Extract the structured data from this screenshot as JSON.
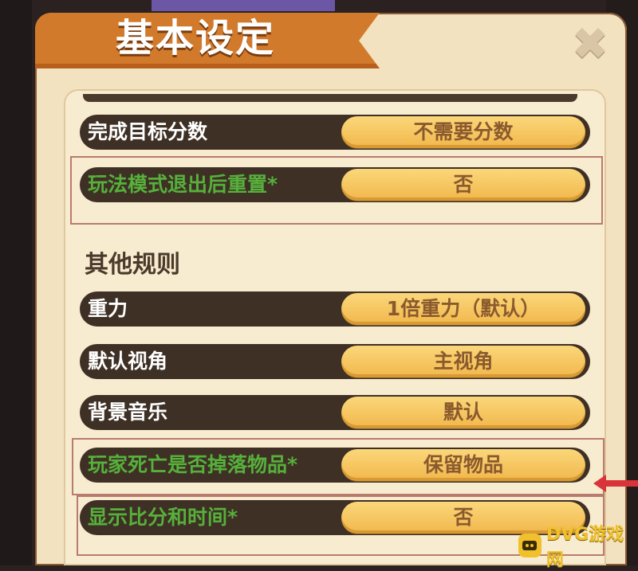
{
  "header": {
    "title": "基本设定"
  },
  "close": {
    "glyph": "✖"
  },
  "rows_top": [
    {
      "label": "完成目标分数",
      "value": "不需要分数",
      "highlight": false
    },
    {
      "label": "玩法模式退出后重置*",
      "value": "否",
      "highlight": true
    }
  ],
  "section": {
    "title": "其他规则"
  },
  "rows_other": [
    {
      "label": "重力",
      "value": "1倍重力（默认）",
      "highlight": false
    },
    {
      "label": "默认视角",
      "value": "主视角",
      "highlight": false
    },
    {
      "label": "背景音乐",
      "value": "默认",
      "highlight": false
    },
    {
      "label": "玩家死亡是否掉落物品*",
      "value": "保留物品",
      "highlight": true
    },
    {
      "label": "显示比分和时间*",
      "value": "否",
      "highlight": true
    }
  ],
  "watermark": {
    "text": "DVG游戏网"
  },
  "colors": {
    "banner": "#d27a2c",
    "panel": "#f3e2bf",
    "row_bg": "#3e3025",
    "value_pill": "#f1b74b",
    "highlight_label": "#56b03b",
    "highlight_box": "#b97b6d",
    "arrow": "#d9343a"
  }
}
